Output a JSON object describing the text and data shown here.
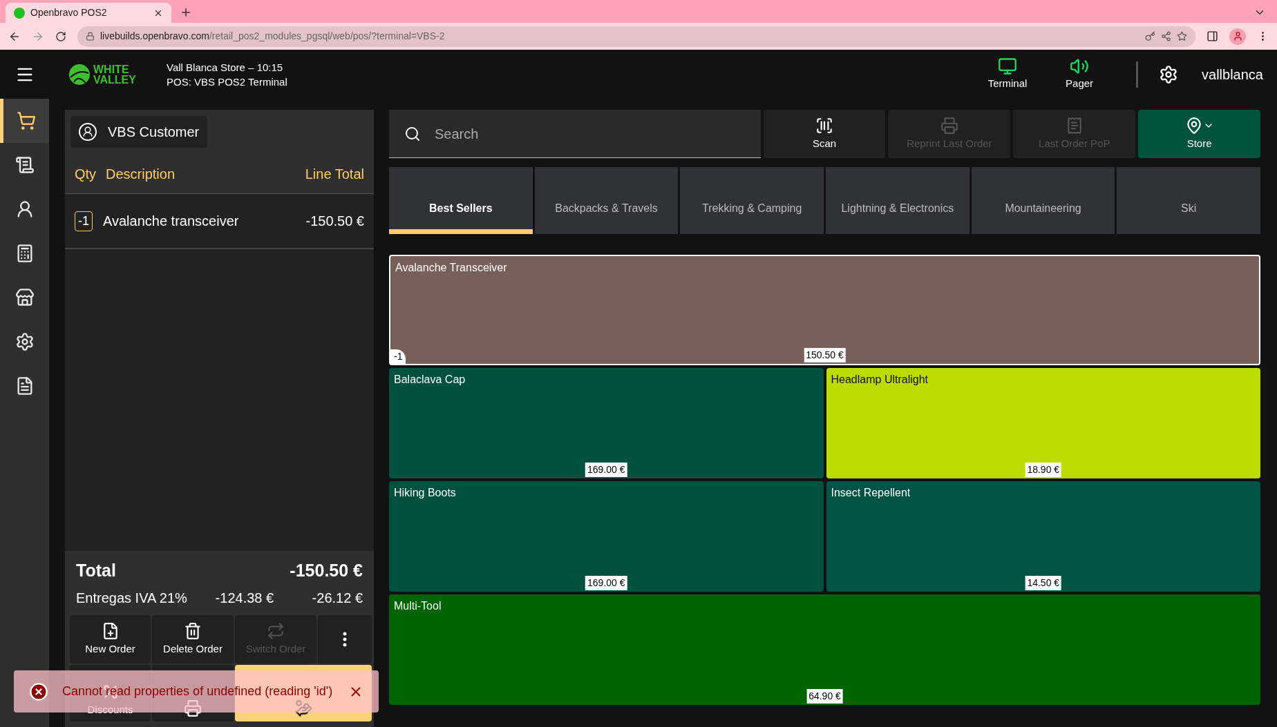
{
  "browser": {
    "tab_title": "Openbravo POS2",
    "url_host": "livebuilds.openbravo.com",
    "url_path": "/retail_pos2_modules_pgsql/web/pos/?terminal=VBS-2"
  },
  "header": {
    "logo_line1": "WHITE",
    "logo_line2": "VALLEY",
    "store": "Vall Blanca Store – 10:15",
    "terminal": "POS: VBS POS2 Terminal",
    "actions": [
      {
        "label": "Terminal",
        "kind": "terminal"
      },
      {
        "label": "Pager",
        "kind": "pager"
      }
    ],
    "user": "vallblanca"
  },
  "nav": [
    {
      "kind": "cart",
      "selected": true
    },
    {
      "kind": "receipt",
      "selected": false
    },
    {
      "kind": "customer",
      "selected": false
    },
    {
      "kind": "register",
      "selected": false
    },
    {
      "kind": "store",
      "selected": false
    },
    {
      "kind": "settings",
      "selected": false
    },
    {
      "kind": "document",
      "selected": false
    }
  ],
  "order": {
    "customer": "VBS Customer",
    "columns": [
      "Qty",
      "Description",
      "Line Total"
    ],
    "lines": [
      {
        "qty": "-1",
        "description": "Avalanche transceiver",
        "total": "-150.50 €"
      }
    ],
    "total_label": "Total",
    "total": "-150.50 €",
    "tax": {
      "name": "Entregas IVA 21%",
      "base": "-124.38 €",
      "amount": "-26.12 €"
    },
    "buttons": [
      {
        "label": "New Order",
        "kind": "new",
        "disabled": false
      },
      {
        "label": "Delete Order",
        "kind": "delete",
        "disabled": false
      },
      {
        "label": "Switch Order",
        "kind": "switch",
        "disabled": true
      },
      {
        "kind": "more",
        "disabled": false
      },
      {
        "label": "Discounts",
        "kind": "discounts"
      },
      {
        "kind": "print"
      },
      {
        "kind": "pay"
      }
    ]
  },
  "toolbar": {
    "search_placeholder": "Search",
    "buttons": [
      {
        "label": "Scan",
        "kind": "scan",
        "disabled": false
      },
      {
        "label": "Reprint Last Order",
        "kind": "reprint",
        "disabled": true
      },
      {
        "label": "Last Order PoP",
        "kind": "pop",
        "disabled": true
      },
      {
        "label": "Store",
        "kind": "store",
        "disabled": false
      }
    ]
  },
  "categories": [
    {
      "label": "Best Sellers",
      "selected": true
    },
    {
      "label": "Backpacks & Travels",
      "selected": false
    },
    {
      "label": "Trekking & Camping",
      "selected": false
    },
    {
      "label": "Lightning & Electronics",
      "selected": false
    },
    {
      "label": "Mountaineering",
      "selected": false
    },
    {
      "label": "Ski",
      "selected": false
    }
  ],
  "products": [
    {
      "name": "Avalanche Transceiver",
      "price": "150.50 €",
      "qty": "-1",
      "color": "#785f59",
      "kind": "wide",
      "selected": true
    },
    {
      "name": "Balaclava Cap",
      "price": "169.00 €",
      "color": "#005140",
      "kind": "half",
      "selected": false
    },
    {
      "name": "Headlamp Ultralight",
      "price": "18.90 €",
      "color": "#bcdc00",
      "kind": "half",
      "selected": false
    },
    {
      "name": "Hiking Boots",
      "price": "169.00 €",
      "color": "#00503f",
      "kind": "half",
      "selected": false
    },
    {
      "name": "Insect Repellent",
      "price": "14.50 €",
      "color": "#005345",
      "kind": "half",
      "selected": false
    },
    {
      "name": "Multi-Tool",
      "price": "64.90 €",
      "color": "#006400",
      "kind": "wide",
      "selected": false
    }
  ],
  "toast": {
    "message": "Cannot read properties of undefined (reading 'id')"
  }
}
